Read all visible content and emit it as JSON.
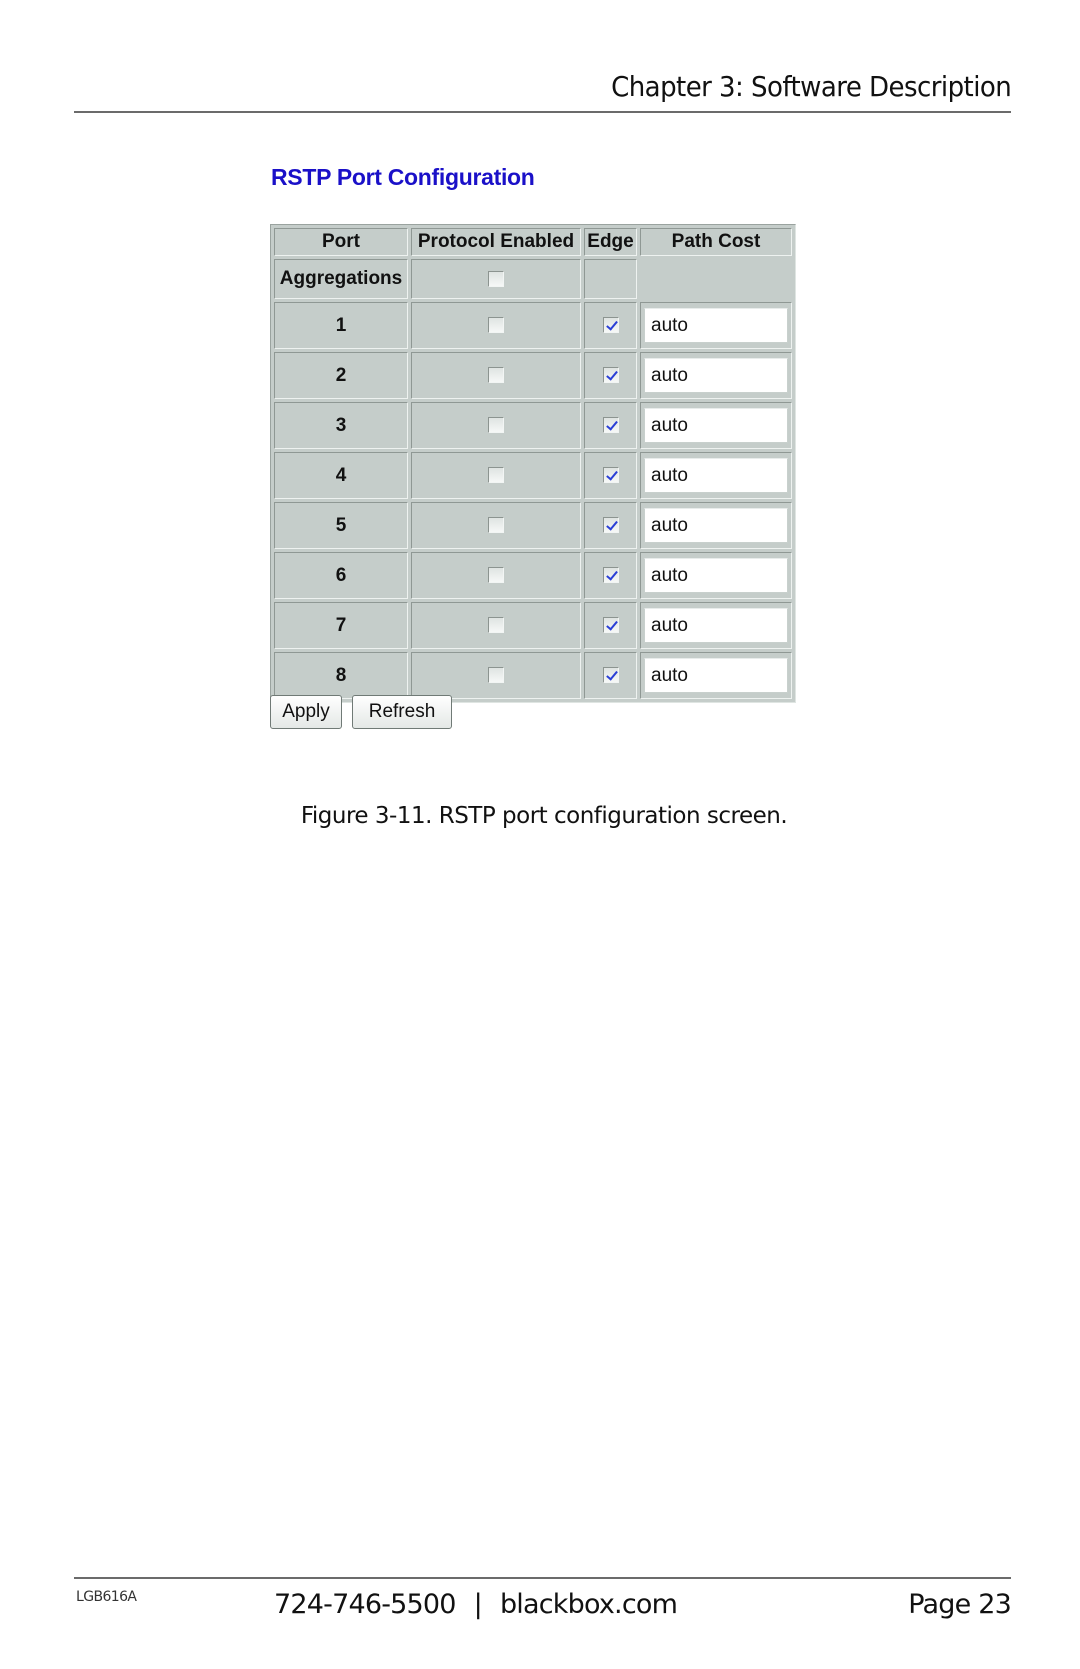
{
  "header": {
    "chapter_title": "Chapter 3: Software Description"
  },
  "screen": {
    "title": "RSTP Port Configuration",
    "title_color": "#1a10c8",
    "table": {
      "columns": [
        "Port",
        "Protocol Enabled",
        "Edge",
        "Path Cost"
      ],
      "aggregations": {
        "label": "Aggregations",
        "protocol_enabled": false
      },
      "rows": [
        {
          "port": "1",
          "protocol_enabled": false,
          "edge": true,
          "path_cost": "auto"
        },
        {
          "port": "2",
          "protocol_enabled": false,
          "edge": true,
          "path_cost": "auto"
        },
        {
          "port": "3",
          "protocol_enabled": false,
          "edge": true,
          "path_cost": "auto"
        },
        {
          "port": "4",
          "protocol_enabled": false,
          "edge": true,
          "path_cost": "auto"
        },
        {
          "port": "5",
          "protocol_enabled": false,
          "edge": true,
          "path_cost": "auto"
        },
        {
          "port": "6",
          "protocol_enabled": false,
          "edge": true,
          "path_cost": "auto"
        },
        {
          "port": "7",
          "protocol_enabled": false,
          "edge": true,
          "path_cost": "auto"
        },
        {
          "port": "8",
          "protocol_enabled": false,
          "edge": true,
          "path_cost": "auto"
        }
      ]
    },
    "buttons": {
      "apply": "Apply",
      "refresh": "Refresh"
    }
  },
  "caption": "Figure 3-11. RSTP port configuration screen.",
  "footer": {
    "doc_code": "LGB616A",
    "phone": "724-746-5500",
    "separator": "|",
    "website": "blackbox.com",
    "page": "Page 23"
  }
}
